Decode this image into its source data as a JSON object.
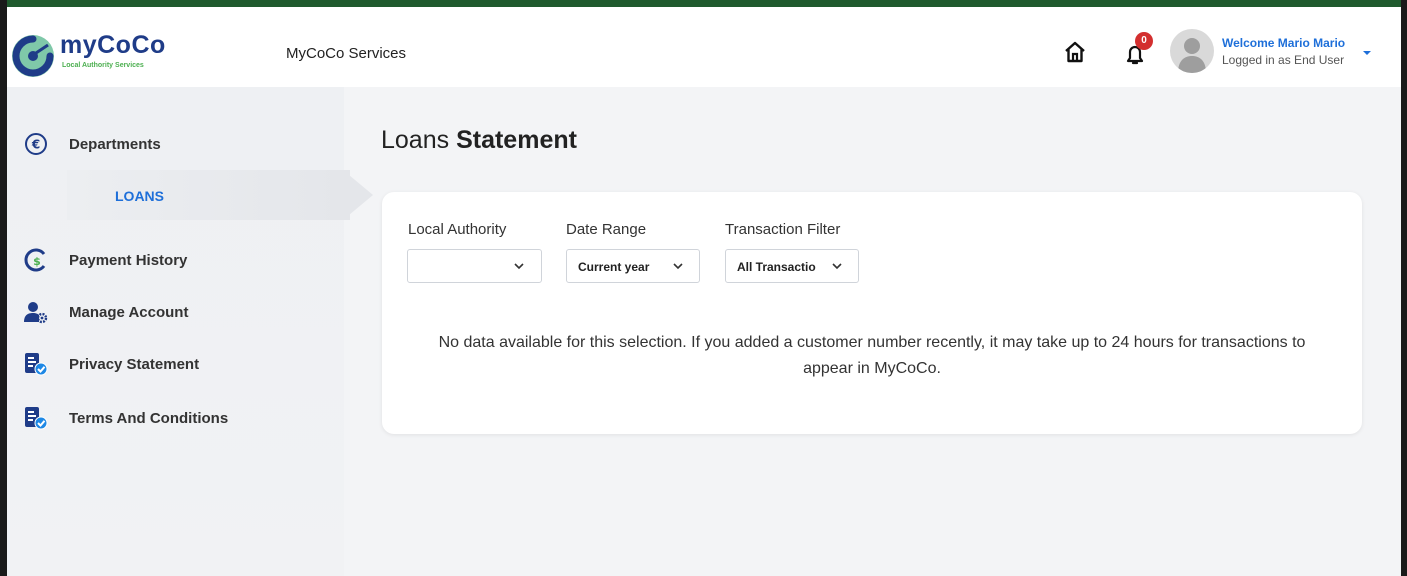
{
  "header": {
    "logo_text": "myCoCo",
    "logo_subtitle": "Local Authority Services",
    "app_title": "MyCoCo Services",
    "notification_count": "0",
    "user_welcome": "Welcome Mario Mario",
    "user_role": "Logged in as End User"
  },
  "sidebar": {
    "items": [
      {
        "label": "Departments",
        "icon": "euro-icon"
      },
      {
        "label": "Payment History",
        "icon": "payment-history-icon"
      },
      {
        "label": "Manage Account",
        "icon": "user-settings-icon"
      },
      {
        "label": "Privacy Statement",
        "icon": "document-check-icon"
      },
      {
        "label": "Terms And Conditions",
        "icon": "document-check-icon"
      }
    ],
    "sub_item": {
      "label": "LOANS",
      "active": true
    }
  },
  "main": {
    "title_light": "Loans",
    "title_bold": "Statement",
    "filters": [
      {
        "label": "Local Authority",
        "value": ""
      },
      {
        "label": "Date Range",
        "value": "Current year"
      },
      {
        "label": "Transaction Filter",
        "value": "All Transactio"
      }
    ],
    "empty_message": "No data available for this selection. If you added a customer number recently, it may take up to 24 hours for transactions to appear in MyCoCo."
  },
  "colors": {
    "accent": "#1e6fd9",
    "brand_navy": "#1f3c88",
    "brand_green": "#4caf50",
    "badge": "#d32f2f"
  }
}
